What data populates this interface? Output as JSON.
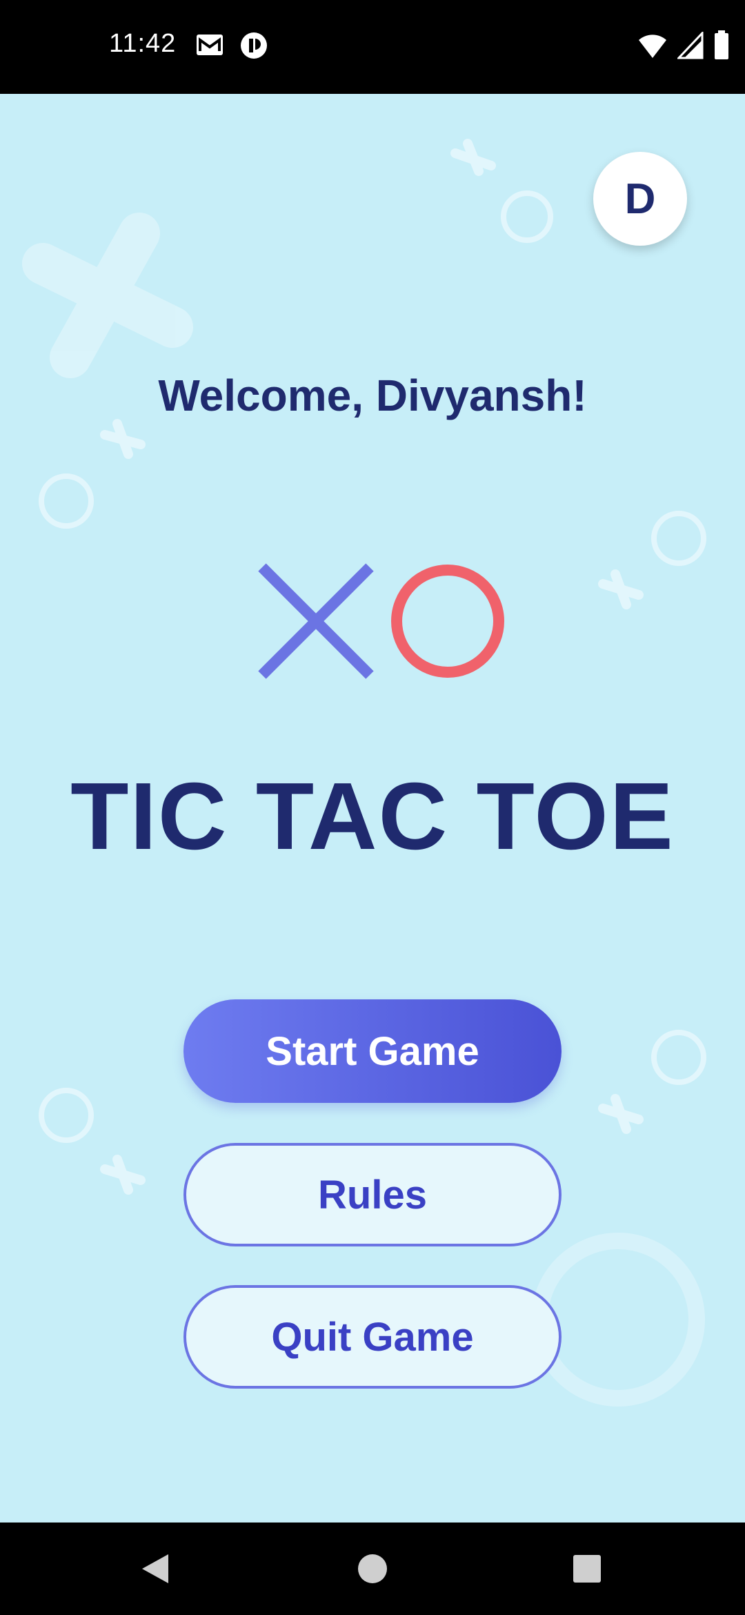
{
  "status_bar": {
    "time": "11:42",
    "icons_left": [
      "gmail-icon",
      "app-notification-icon"
    ],
    "icons_right": [
      "wifi-icon",
      "cell-signal-icon",
      "battery-icon"
    ]
  },
  "header": {
    "avatar_letter": "D"
  },
  "main": {
    "welcome_text": "Welcome, Divyansh!",
    "logo": {
      "x_color": "#6b74e3",
      "o_color": "#f0626b"
    },
    "title": "TIC TAC TOE"
  },
  "buttons": {
    "start_label": "Start Game",
    "rules_label": "Rules",
    "quit_label": "Quit Game"
  },
  "nav_bar": {
    "icons": [
      "back-icon",
      "home-icon",
      "recents-icon"
    ]
  },
  "colors": {
    "background": "#c7eef8",
    "title": "#1f2a6e",
    "primary_start": "#6e7cf0",
    "primary_end": "#4a52d6"
  }
}
